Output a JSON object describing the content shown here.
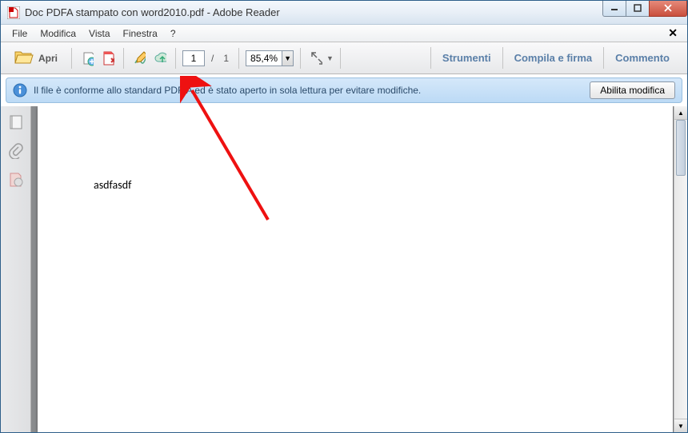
{
  "window": {
    "title": "Doc PDFA stampato con word2010.pdf - Adobe Reader"
  },
  "menubar": {
    "items": [
      "File",
      "Modifica",
      "Vista",
      "Finestra",
      "?"
    ]
  },
  "toolbar": {
    "open_label": "Apri",
    "page_current": "1",
    "page_separator": "/",
    "page_total": "1",
    "zoom": "85,4%",
    "links": {
      "tools": "Strumenti",
      "fill_sign": "Compila e firma",
      "comment": "Commento"
    }
  },
  "infobar": {
    "message": "Il file è conforme allo standard PDF/A ed è stato aperto in sola lettura per evitare modifiche.",
    "enable_edit": "Abilita modifica"
  },
  "document": {
    "body_text": "asdfasdf"
  }
}
